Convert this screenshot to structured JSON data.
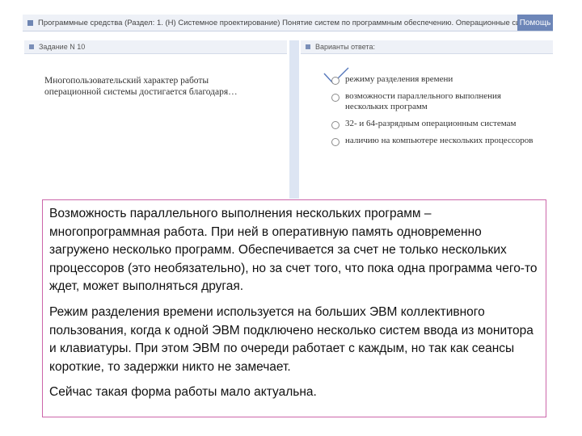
{
  "topbar": {
    "title": "Программные средства (Раздел: 1. (Н) Системное проектирование) Понятие систем по программным обеспечению. Операционные системы",
    "help_label": "Помощь"
  },
  "task_header": {
    "label": "Задание N 10"
  },
  "answer_header": {
    "label": "Варианты ответа:"
  },
  "question": {
    "text": "Многопользовательский характер работы операционной системы достигается благодаря…"
  },
  "answers": [
    {
      "text": "режиму разделения времени",
      "selected": true
    },
    {
      "text": "возможности параллельного выполнения нескольких программ",
      "selected": false
    },
    {
      "text": "32- и 64-разрядным операционным системам",
      "selected": false
    },
    {
      "text": "наличию на компьютере нескольких процессоров",
      "selected": false
    }
  ],
  "explanation": {
    "p1": "Возможность параллельного выполнения нескольких программ – многопрограммная работа. При ней в оперативную память одновременно загружено несколько программ. Обеспечивается за счет не только нескольких процессоров (это необязательно), но за счет того, что пока одна программа чего-то ждет, может выполняться другая.",
    "p2": "Режим разделения времени используется на больших ЭВМ коллективного пользования, когда к одной ЭВМ подключено несколько систем ввода из монитора и клавиатуры. При этом ЭВМ по очереди работает с каждым, но так как сеансы короткие, то задержки никто не замечает.",
    "p3": "Сейчас такая форма работы мало актуальна."
  },
  "colors": {
    "header_bg": "#eef1f7",
    "accent": "#6d86b8",
    "explanation_border": "#cc66aa",
    "check_mark": "#5577bb"
  }
}
